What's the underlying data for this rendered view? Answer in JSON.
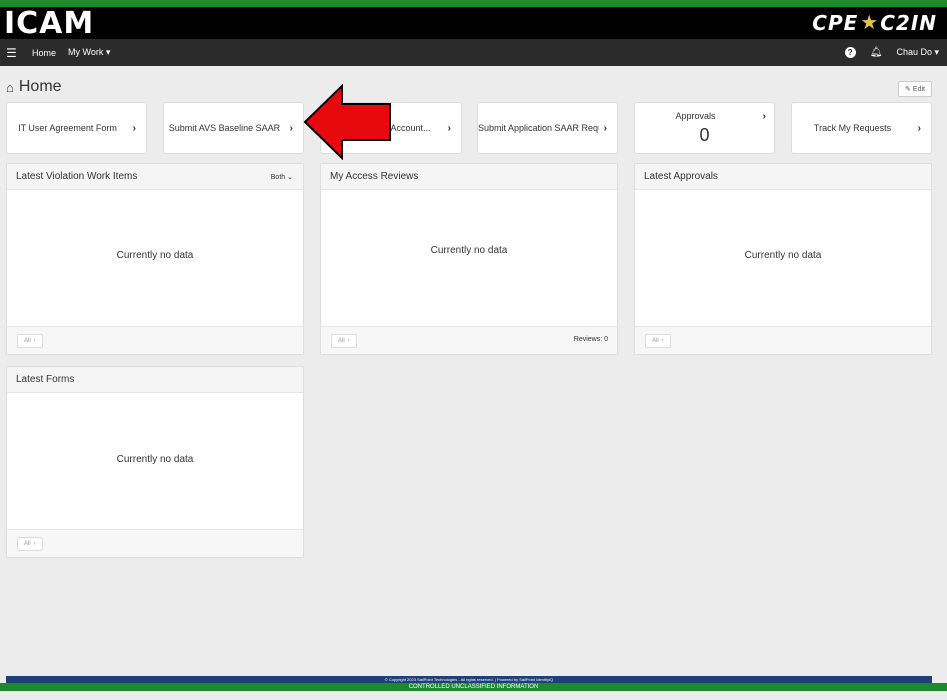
{
  "brand": {
    "logo_left": "ICAM",
    "logo_right_a": "CPE",
    "logo_right_b": "C2IN"
  },
  "nav": {
    "home": "Home",
    "my_work": "My Work ▾",
    "user": "Chau Do ▾"
  },
  "page": {
    "title": "Home",
    "edit": "Edit"
  },
  "tiles": [
    {
      "label": "IT User Agreement Form"
    },
    {
      "label": "Submit AVS Baseline SAAR"
    },
    {
      "label": "ged Account..."
    },
    {
      "label": "Submit Application SAAR Requ..."
    },
    {
      "label": "Approvals",
      "count": "0"
    },
    {
      "label": "Track My Requests"
    }
  ],
  "widgets": {
    "violations": {
      "title": "Latest Violation Work Items",
      "filter": "Both",
      "empty": "Currently no data",
      "all": "All"
    },
    "reviews": {
      "title": "My Access Reviews",
      "empty": "Currently no data",
      "all": "All",
      "count": "Reviews: 0"
    },
    "approvals": {
      "title": "Latest Approvals",
      "empty": "Currently no data",
      "all": "All"
    },
    "forms": {
      "title": "Latest Forms",
      "empty": "Currently no data",
      "all": "All"
    }
  },
  "footer": {
    "copyright": "© Copyright 2023 SailPoint Technologies - All rights reserved. | Powered by SailPoint IdentityIQ",
    "classification": "CONTROLLED UNCLASSIFIED INFORMATION"
  },
  "colors": {
    "brand_green": "#1a8a2a",
    "nav_dark": "#2b2b2b",
    "arrow_red": "#e8090f",
    "footer_blue": "#1f3f77"
  }
}
